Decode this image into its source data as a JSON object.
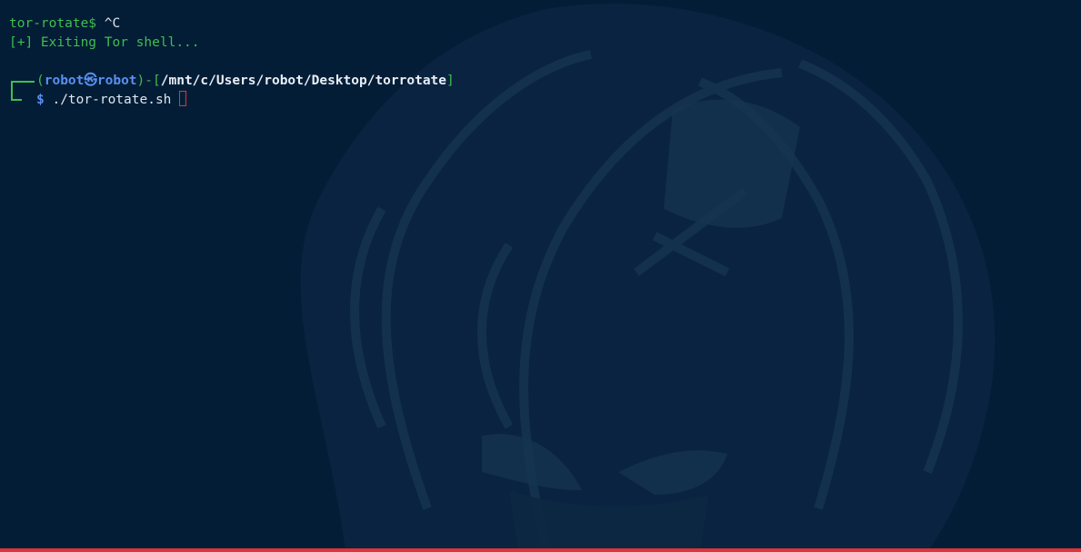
{
  "terminal": {
    "prev_prompt": "tor-rotate$",
    "prev_input": " ^C",
    "info_line": "[+] Exiting Tor shell...",
    "user": "robot",
    "at_symbol": "㉿",
    "host": "robot",
    "path": "/mnt/c/Users/robot/Desktop/torrotate",
    "dash": "-",
    "open_paren": "(",
    "close_paren": ")",
    "open_bracket": "[",
    "close_bracket": "]",
    "prompt_symbol": "$",
    "command": " ./tor-rotate.sh "
  },
  "colors": {
    "background": "#031d36",
    "prompt_green": "#3fbf4e",
    "user_blue": "#5a8ff0",
    "cursor_red": "#e0333a",
    "status_strip": "#e0333a",
    "wallpaper_tint": "#0f2d4a"
  }
}
